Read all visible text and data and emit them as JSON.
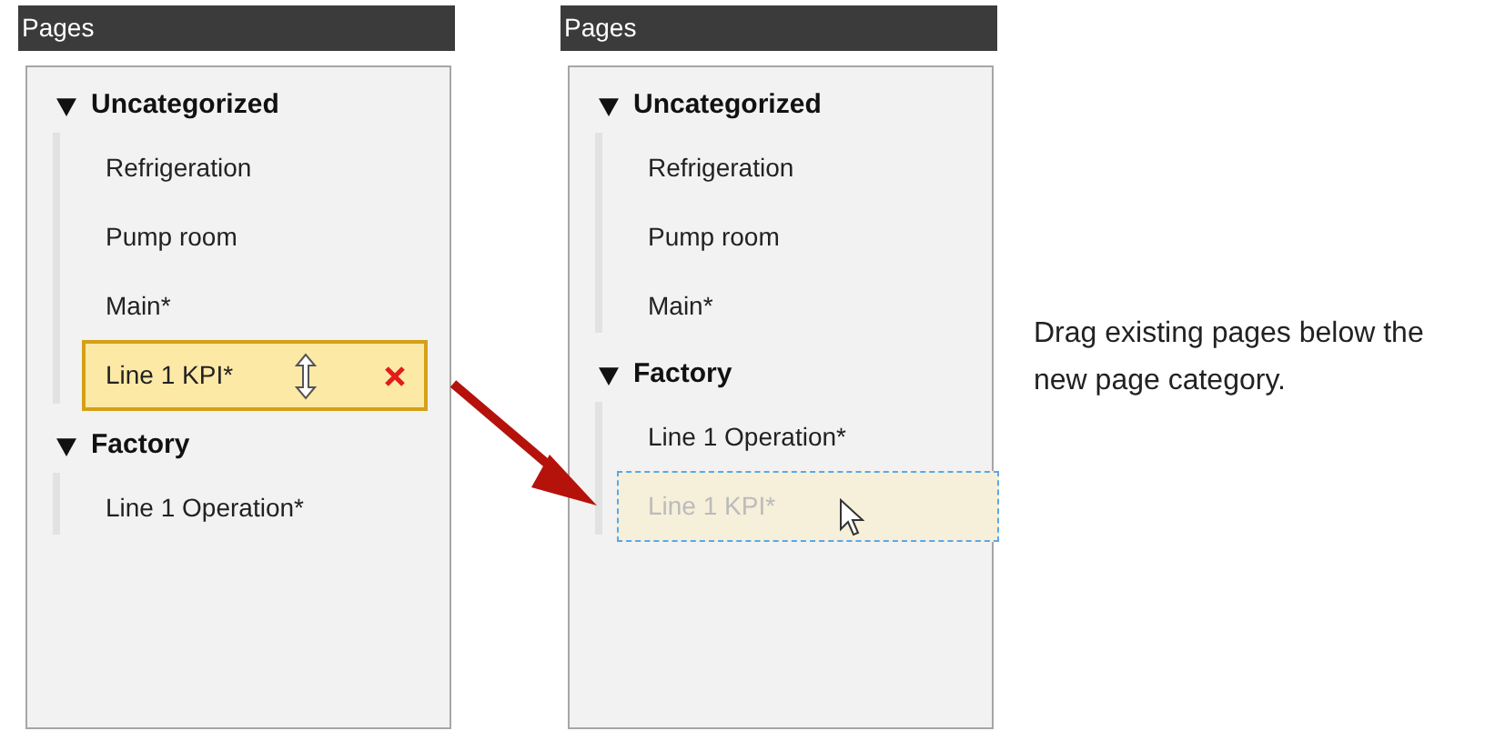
{
  "panels": [
    {
      "title": "Pages",
      "categories": [
        {
          "name": "Uncategorized",
          "expanded": true,
          "pages": [
            {
              "name": "Refrigeration",
              "kind": "item"
            },
            {
              "name": "Pump room",
              "kind": "item"
            },
            {
              "name": "Main*",
              "kind": "item"
            },
            {
              "name": "Line 1 KPI*",
              "kind": "dragging"
            }
          ]
        },
        {
          "name": "Factory",
          "expanded": true,
          "pages": [
            {
              "name": "Line 1 Operation*",
              "kind": "item"
            }
          ]
        }
      ]
    },
    {
      "title": "Pages",
      "categories": [
        {
          "name": "Uncategorized",
          "expanded": true,
          "pages": [
            {
              "name": "Refrigeration",
              "kind": "item"
            },
            {
              "name": "Pump room",
              "kind": "item"
            },
            {
              "name": "Main*",
              "kind": "item"
            }
          ]
        },
        {
          "name": "Factory",
          "expanded": true,
          "pages": [
            {
              "name": "Line 1 Operation*",
              "kind": "item"
            },
            {
              "name": "Line 1 KPI*",
              "kind": "drop-target"
            }
          ]
        }
      ]
    }
  ],
  "caption": "Drag existing pages below the new page category."
}
